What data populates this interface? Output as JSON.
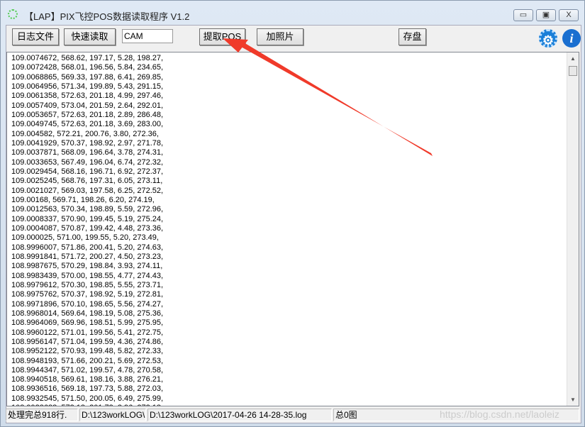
{
  "window": {
    "title": "【LAP】PIX飞控POS数据读取程序 V1.2",
    "minimize": "▭",
    "maximize": "▣",
    "close": "X"
  },
  "toolbar": {
    "log_file": "日志文件",
    "quick_read": "快速读取",
    "cam_value": "CAM",
    "extract_pos": "提取POS",
    "add_photo": "加照片",
    "save": "存盘",
    "settings_icon": "gear-icon",
    "info_icon": "info-icon"
  },
  "lines": [
    "109.0074672, 568.62, 197.17, 5.28, 198.27,",
    "109.0072428, 568.01, 196.56, 5.84, 234.65,",
    "109.0068865, 569.33, 197.88, 6.41, 269.85,",
    "109.0064956, 571.34, 199.89, 5.43, 291.15,",
    "109.0061358, 572.63, 201.18, 4.99, 297.46,",
    "109.0057409, 573.04, 201.59, 2.64, 292.01,",
    "109.0053657, 572.63, 201.18, 2.89, 286.48,",
    "109.0049745, 572.63, 201.18, 3.69, 283.00,",
    "109.004582, 572.21, 200.76, 3.80, 272.36,",
    "109.0041929, 570.37, 198.92, 2.97, 271.78,",
    "109.0037871, 568.09, 196.64, 3.78, 274.31,",
    "109.0033653, 567.49, 196.04, 6.74, 272.32,",
    "109.0029454, 568.16, 196.71, 6.92, 272.37,",
    "109.0025245, 568.76, 197.31, 6.05, 273.11,",
    "109.0021027, 569.03, 197.58, 6.25, 272.52,",
    "109.00168, 569.71, 198.26, 6.20, 274.19,",
    "109.0012563, 570.34, 198.89, 5.59, 272.96,",
    "109.0008337, 570.90, 199.45, 5.19, 275.24,",
    "109.0004087, 570.87, 199.42, 4.48, 273.36,",
    "109.000025, 571.00, 199.55, 5.20, 273.49,",
    "108.9996007, 571.86, 200.41, 5.20, 274.63,",
    "108.9991841, 571.72, 200.27, 4.50, 273.23,",
    "108.9987675, 570.29, 198.84, 3.93, 274.11,",
    "108.9983439, 570.00, 198.55, 4.77, 274.43,",
    "108.9979612, 570.30, 198.85, 5.55, 273.71,",
    "108.9975762, 570.37, 198.92, 5.19, 272.81,",
    "108.9971896, 570.10, 198.65, 5.56, 274.27,",
    "108.9968014, 569.64, 198.19, 5.08, 275.36,",
    "108.9964069, 569.96, 198.51, 5.99, 275.95,",
    "108.9960122, 571.01, 199.56, 5.41, 272.75,",
    "108.9956147, 571.04, 199.59, 4.36, 274.86,",
    "108.9952122, 570.93, 199.48, 5.82, 272.33,",
    "108.9948193, 571.66, 200.21, 5.69, 272.53,",
    "108.9944347, 571.02, 199.57, 4.78, 270.58,",
    "108.9940518, 569.61, 198.16, 3.88, 276.21,",
    "108.9936516, 569.18, 197.73, 5.88, 272.03,",
    "108.9932545, 571.50, 200.05, 6.49, 275.99,",
    "108.9928688, 573.18, 201.73, 3.96, 272.18,"
  ],
  "scrollbar": {
    "up": "▲",
    "down": "▼"
  },
  "status": {
    "lines": "处理完总918行.",
    "dir": "D:\\123workLOG\\",
    "file": "D:\\123workLOG\\2017-04-26 14-28-35.log",
    "images": "总0图"
  },
  "watermark": "https://blog.csdn.net/laoleiz",
  "colors": {
    "arrow": "#f03a2a",
    "gear": "#1a7fd8",
    "info": "#1a6fd0"
  }
}
